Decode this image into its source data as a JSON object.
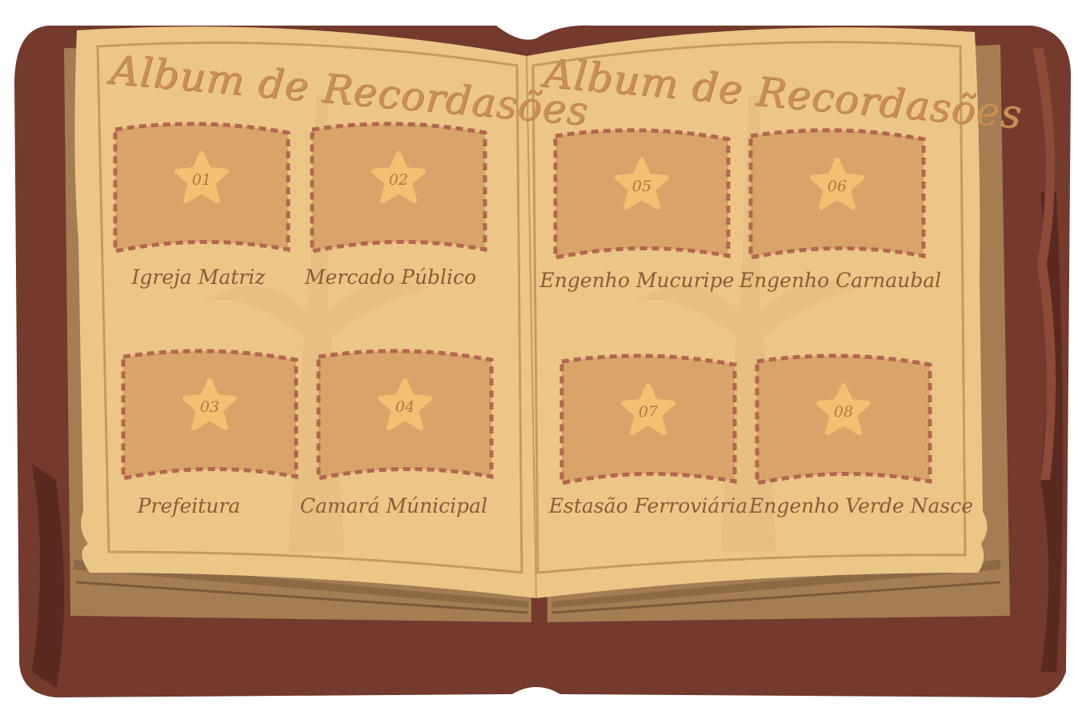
{
  "album": {
    "title_left": "Album de Recordasões",
    "title_right": "Album de Recordasões"
  },
  "slots": [
    {
      "number": "01",
      "label": "Igreja Matriz"
    },
    {
      "number": "02",
      "label": "Mercado Público"
    },
    {
      "number": "03",
      "label": "Prefeitura"
    },
    {
      "number": "04",
      "label": "Camará Múnicipal"
    },
    {
      "number": "05",
      "label": "Engenho Mucuripe"
    },
    {
      "number": "06",
      "label": "Engenho Carnaubal"
    },
    {
      "number": "07",
      "label": "Estasão Ferroviária"
    },
    {
      "number": "08",
      "label": "Engenho Verde Nasce"
    }
  ],
  "colors": {
    "cover": "#733a2d",
    "cover_dark": "#5a2a20",
    "page": "#ecc687",
    "page_edge": "#a47d52",
    "slot_fill": "#d8a46a",
    "slot_dash": "#b3664f",
    "star": "#f3c071",
    "label": "#8a5a3a"
  }
}
